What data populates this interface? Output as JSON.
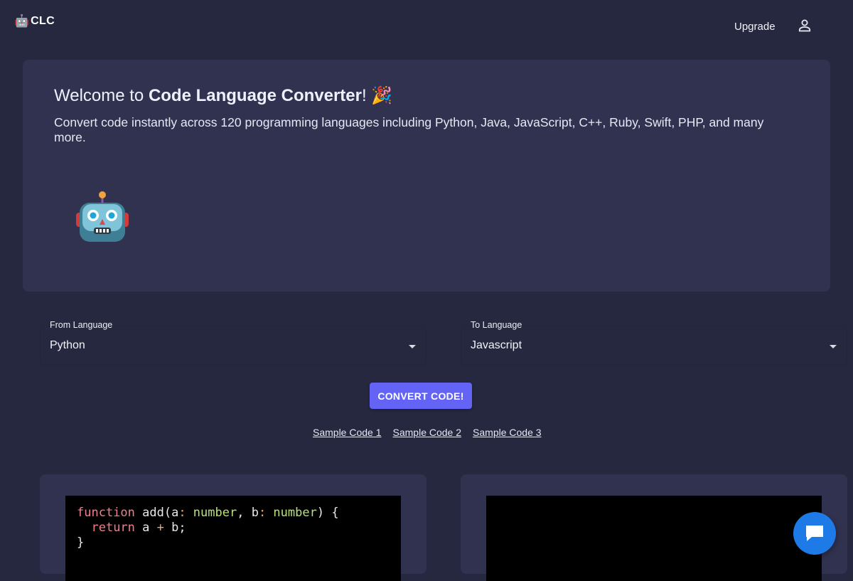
{
  "header": {
    "logo_emoji": "🤖",
    "logo_text": "CLC",
    "upgrade_label": "Upgrade",
    "user_icon": "user-icon"
  },
  "hero": {
    "title_prefix": "Welcome to ",
    "title_bold": "Code Language Converter",
    "title_suffix": "! 🎉",
    "subtitle": "Convert code instantly across 120 programming languages including Python, Java, JavaScript, C++, Ruby, Swift, PHP, and many more.",
    "mascot": "robot-icon"
  },
  "converter": {
    "from": {
      "label": "From Language",
      "value": "Python"
    },
    "to": {
      "label": "To Language",
      "value": "Javascript"
    },
    "convert_label": "CONVERT CODE!",
    "samples": [
      "Sample Code 1",
      "Sample Code 2",
      "Sample Code 3"
    ]
  },
  "editors": {
    "input_code": {
      "line1": {
        "kw": "function",
        "name": " add(a",
        "colon1": ":",
        "type1": " number",
        "sep": ", b",
        "colon2": ":",
        "type2": " number",
        "end": ") {"
      },
      "line2": {
        "indent": "  ",
        "kw": "return",
        "expr1": " a ",
        "op": "+",
        "expr2": " b;"
      },
      "line3": "}"
    },
    "output_code": ""
  },
  "chat": {
    "icon": "chat-bubble-icon"
  },
  "colors": {
    "background": "#262840",
    "card": "#30324f",
    "accent": "#6363f5",
    "chat": "#1e7ae6"
  }
}
